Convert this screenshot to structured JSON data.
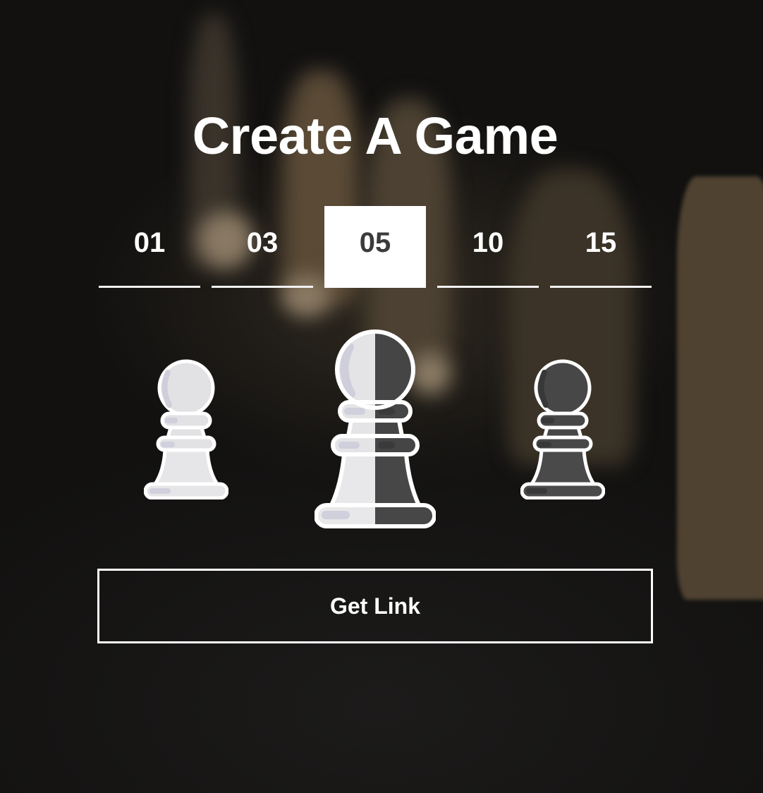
{
  "page": {
    "title": "Create A Game"
  },
  "time_options": {
    "items": [
      {
        "label": "01",
        "selected": false
      },
      {
        "label": "03",
        "selected": false
      },
      {
        "label": "05",
        "selected": true
      },
      {
        "label": "10",
        "selected": false
      },
      {
        "label": "15",
        "selected": false
      }
    ]
  },
  "color_choices": {
    "items": [
      {
        "icon": "white-pawn-icon",
        "color": "white"
      },
      {
        "icon": "half-white-half-black-pawn-icon",
        "color": "random"
      },
      {
        "icon": "black-pawn-icon",
        "color": "black"
      }
    ]
  },
  "actions": {
    "get_link_label": "Get Link"
  },
  "colors": {
    "text": "#ffffff",
    "selected_tab_bg": "#ffffff",
    "selected_tab_text": "#3b3b3b",
    "pawn_light": "#e6e6e8",
    "pawn_light_shade": "#d0cfdc",
    "pawn_dark": "#4a4a4a",
    "pawn_dark_shade": "#3a3a3a",
    "outline": "#ffffff"
  }
}
